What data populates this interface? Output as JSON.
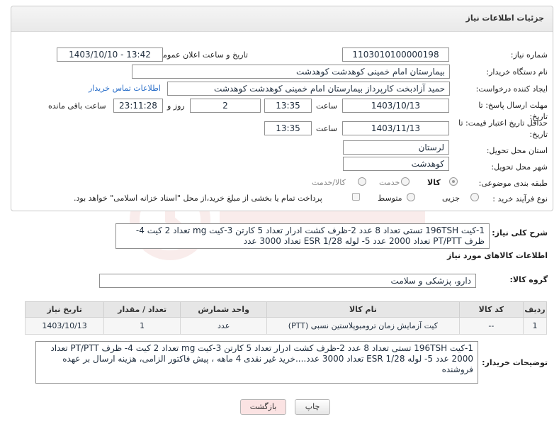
{
  "page": {
    "title": "جزئیات اطلاعات نیاز"
  },
  "form": {
    "need_number_label": "شماره نیاز:",
    "need_number": "1103010100000198",
    "announce_label": "تاریخ و ساعت اعلان عمومی:",
    "announce_value": "1403/10/10 - 13:42",
    "buyer_label": "نام دستگاه خریدار:",
    "buyer_value": "بیمارستان امام خمینی کوهدشت کوهدشت",
    "creator_label": "ایجاد کننده درخواست:",
    "creator_value": "حمید آزادبخت کارپرداز بیمارستان امام خمینی کوهدشت کوهدشت",
    "contact_link": "اطلاعات تماس خریدار",
    "deadline_label": "مهلت ارسال پاسخ: تا تاریخ:",
    "deadline_date": "1403/10/13",
    "time_label": "ساعت",
    "deadline_time": "13:35",
    "days_value": "2",
    "days_label": "روز و",
    "remaining_time": "23:11:28",
    "remaining_label": "ساعت باقی مانده",
    "validity_label": "حداقل تاریخ اعتبار قیمت: تا تاریخ:",
    "validity_date": "1403/11/13",
    "validity_time": "13:35",
    "province_label": "استان محل تحویل:",
    "province_value": "لرستان",
    "city_label": "شهر محل تحویل:",
    "city_value": "کوهدشت",
    "category_label": "طبقه بندی موضوعی:",
    "category_options": [
      "کالا",
      "خدمت",
      "کالا/خدمت"
    ],
    "process_label": "نوع فرآیند خرید :",
    "process_options": [
      "جزیی",
      "متوسط"
    ],
    "process_note": "پرداخت تمام یا بخشی از مبلغ خرید،از محل \"اسناد خزانه اسلامی\" خواهد بود."
  },
  "description": {
    "label": "شرح کلی نیاز:",
    "text": "1-کیت  196TSH تستی تعداد 8 عدد 2-ظرف کشت ادرار  تعداد 5 کارتن 3-کیت mg تعداد 2 کیت 4- ظرف PT/PTT تعداد 2000 عدد 5- لوله ESR 1/28 تعداد 3000 عدد"
  },
  "goods": {
    "section_title": "اطلاعات کالاهای مورد نیاز",
    "group_label": "گروه کالا:",
    "group_value": "دارو، پزشکی و سلامت",
    "columns": [
      "ردیف",
      "کد کالا",
      "نام کالا",
      "واحد شمارش",
      "تعداد / مقدار",
      "تاریخ نیاز"
    ],
    "rows": [
      {
        "index": "1",
        "code": "--",
        "name": "کیت آزمایش زمان ترومبوپلاستین نسبی (PTT)",
        "unit": "عدد",
        "qty": "1",
        "date": "1403/10/13"
      }
    ]
  },
  "buyer_notes": {
    "label": "توضیحات خریدار:",
    "text": "1-کیت  196TSH تستی تعداد 8 عدد 2-ظرف کشت ادرار  تعداد 5 کارتن 3-کیت mg تعداد 2 کیت 4- ظرف PT/PTT تعداد 2000 عدد 5- لوله ESR 1/28 تعداد 3000 عدد....خرید غیر نقدی 4 ماهه ، پیش فاکتور الزامی، هزینه ارسال بر عهده فروشنده"
  },
  "buttons": {
    "print": "چاپ",
    "back": "بازگشت"
  },
  "colors": {
    "link": "#2a6fc9",
    "back_button_bg": "#fbe3e3"
  },
  "icons": {
    "watermark": "aria-tender-logo"
  }
}
